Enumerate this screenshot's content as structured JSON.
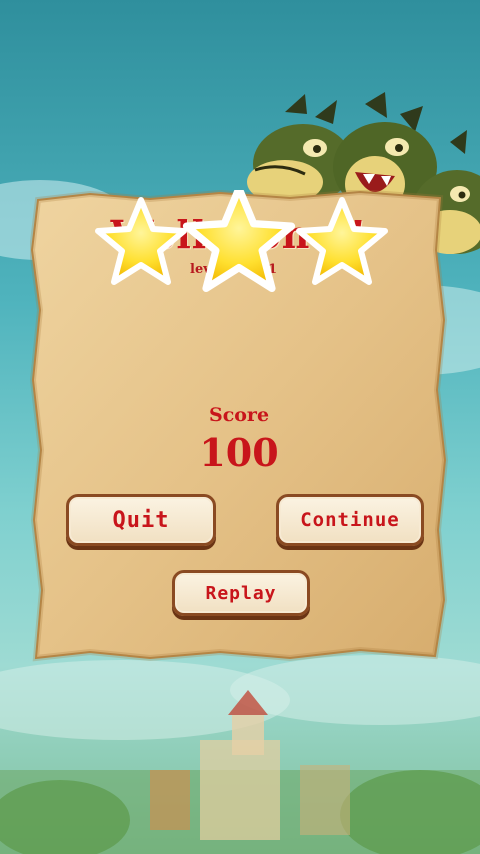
{
  "dialog": {
    "title": "Well Done !",
    "level_label": "level",
    "level_value": "1",
    "stars_earned": 3,
    "stars_total": 3,
    "score_label": "Score",
    "score_value": "100"
  },
  "buttons": {
    "quit": "Quit",
    "continue": "Continue",
    "replay": "Replay"
  },
  "colors": {
    "text_red": "#c8151b",
    "star_yellow": "#ffe24a",
    "parchment": "#e9c98f"
  }
}
